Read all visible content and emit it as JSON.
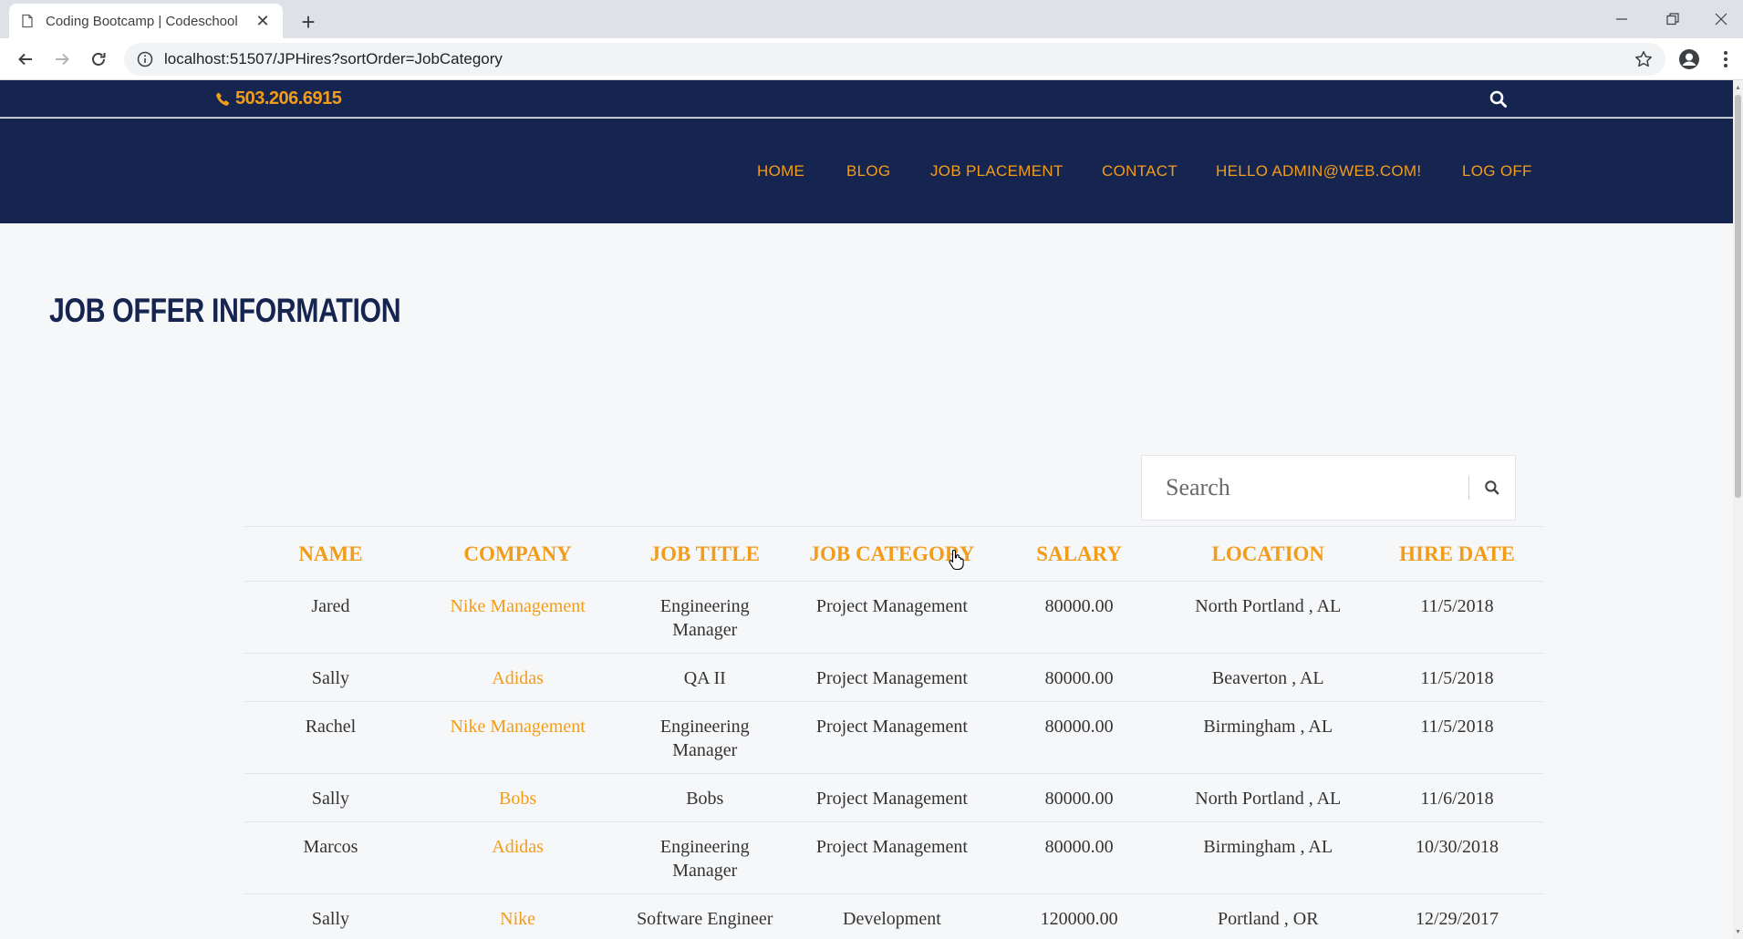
{
  "browser": {
    "tab_title": "Coding Bootcamp | Codeschool",
    "url": "localhost:51507/JPHires?sortOrder=JobCategory",
    "new_tab_symbol": "+",
    "close_symbol": "✕"
  },
  "site": {
    "phone": "503.206.6915",
    "nav": [
      "HOME",
      "BLOG",
      "JOB PLACEMENT",
      "CONTACT",
      "HELLO ADMIN@WEB.COM!",
      "LOG OFF"
    ],
    "brand_color": "#16254f",
    "accent_color": "#f39c1a"
  },
  "page": {
    "title": "JOB OFFER INFORMATION",
    "search_placeholder": "Search"
  },
  "table": {
    "headers": [
      "NAME",
      "COMPANY",
      "JOB TITLE",
      "JOB CATEGORY",
      "SALARY",
      "LOCATION",
      "HIRE DATE"
    ],
    "rows": [
      {
        "name": "Jared",
        "company": "Nike Management",
        "job_title": "Engineering Manager",
        "category": "Project Management",
        "salary": "80000.00",
        "location": "North Portland , AL",
        "hire_date": "11/5/2018"
      },
      {
        "name": "Sally",
        "company": "Adidas",
        "job_title": "QA II",
        "category": "Project Management",
        "salary": "80000.00",
        "location": "Beaverton , AL",
        "hire_date": "11/5/2018"
      },
      {
        "name": "Rachel",
        "company": "Nike Management",
        "job_title": "Engineering Manager",
        "category": "Project Management",
        "salary": "80000.00",
        "location": "Birmingham , AL",
        "hire_date": "11/5/2018"
      },
      {
        "name": "Sally",
        "company": "Bobs",
        "job_title": "Bobs",
        "category": "Project Management",
        "salary": "80000.00",
        "location": "North Portland , AL",
        "hire_date": "11/6/2018"
      },
      {
        "name": "Marcos",
        "company": "Adidas",
        "job_title": "Engineering Manager",
        "category": "Project Management",
        "salary": "80000.00",
        "location": "Birmingham , AL",
        "hire_date": "10/30/2018"
      },
      {
        "name": "Sally",
        "company": "Nike",
        "job_title": "Software Engineer",
        "category": "Development",
        "salary": "120000.00",
        "location": "Portland , OR",
        "hire_date": "12/29/2017"
      }
    ]
  }
}
